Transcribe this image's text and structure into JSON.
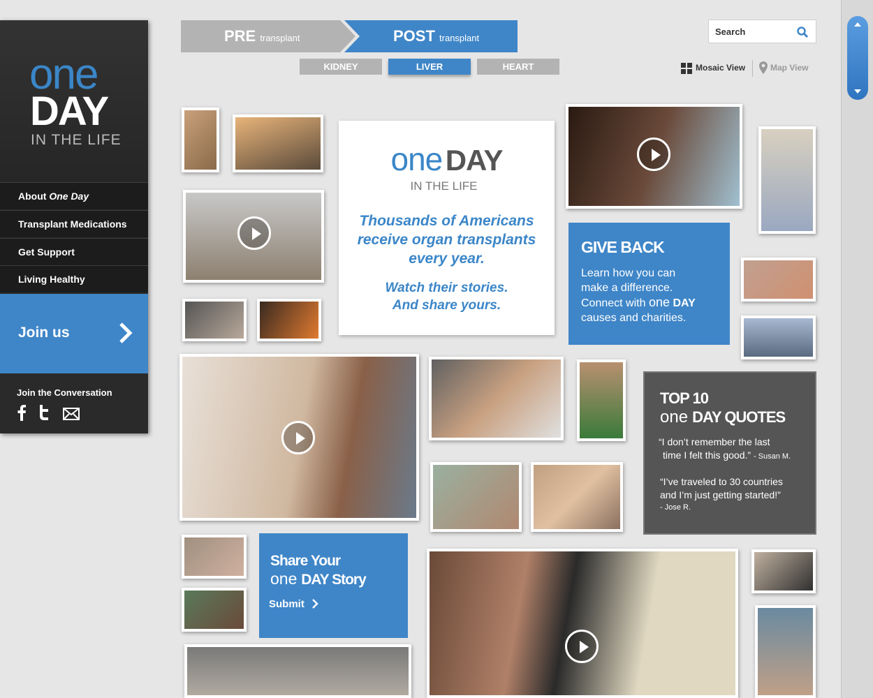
{
  "sidebar": {
    "logo": {
      "one": "one",
      "day": "DAY",
      "life": "IN THE LIFE"
    },
    "nav": [
      {
        "label_pre": "About ",
        "label_em": "One Day"
      },
      {
        "label": "Transplant Medications"
      },
      {
        "label": "Get Support"
      },
      {
        "label": "Living Healthy"
      }
    ],
    "join_label": "Join us",
    "conversation_label": "Join the Conversation",
    "social_icons": [
      "facebook-icon",
      "twitter-icon",
      "email-icon"
    ]
  },
  "top_nav": {
    "pre": {
      "main": "PRE",
      "sub": "transplant"
    },
    "post": {
      "main": "POST",
      "sub": "transplant"
    },
    "organs": [
      "KIDNEY",
      "LIVER",
      "HEART"
    ],
    "selected_organ": "LIVER",
    "search_placeholder": "Search",
    "mosaic_view": "Mosaic View",
    "map_view": "Map View"
  },
  "intro_card": {
    "logo_one": "one",
    "logo_day": "DAY",
    "logo_life": "IN THE LIFE",
    "line1": "Thousands of Americans",
    "line2": "receive organ transplants",
    "line3": "every year.",
    "line4": "Watch their stories.",
    "line5": "And share yours."
  },
  "give_back": {
    "title": "GIVE BACK",
    "line1": "Learn how you can",
    "line2": "make a difference.",
    "line3_pre": "Connect with ",
    "line3_one": "one",
    "line3_day": "DAY",
    "line4": "causes and charities."
  },
  "quotes": {
    "title_top": "TOP 10",
    "title_one": "one",
    "title_rest": "DAY QUOTES",
    "q1_line1": "“I don’t remember the last",
    "q1_line2": "time I felt this good.”",
    "q1_author": "- Susan M.",
    "q2_line1": "“I’ve traveled to 30 countries",
    "q2_line2": "and I’m just getting started!”",
    "q2_author": "- Jose R."
  },
  "share_card": {
    "line1": "Share Your",
    "line2_one": "one",
    "line2_rest": "DAY Story",
    "submit": "Submit"
  },
  "colors": {
    "accent": "#3f86c8",
    "dark": "#2a2a2a",
    "gray_card": "#555555",
    "tab_gray": "#b3b3b3"
  }
}
